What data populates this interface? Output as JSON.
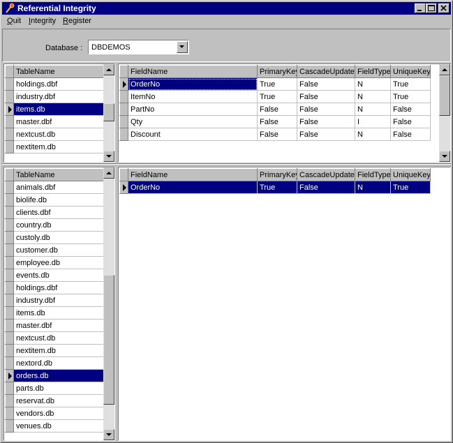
{
  "window": {
    "title": "Referential Integrity"
  },
  "menu": [
    {
      "label": "Quit",
      "ul": "Q",
      "rest": "uit"
    },
    {
      "label": "Integrity",
      "ul": "I",
      "rest": "ntegrity"
    },
    {
      "label": "Register",
      "ul": "R",
      "rest": "egister"
    }
  ],
  "database": {
    "label": "Database :",
    "value": "DBDEMOS"
  },
  "top_tables": {
    "header": "TableName",
    "rows": [
      "holdings.dbf",
      "industry.dbf",
      "items.db",
      "master.dbf",
      "nextcust.db",
      "nextitem.db"
    ],
    "selected": "items.db"
  },
  "top_fields": {
    "headers": [
      "FieldName",
      "PrimaryKey",
      "CascadeUpdate",
      "FieldType",
      "UniqueKey"
    ],
    "rows": [
      [
        "OrderNo",
        "True",
        "False",
        "N",
        "True"
      ],
      [
        "ItemNo",
        "True",
        "False",
        "N",
        "True"
      ],
      [
        "PartNo",
        "False",
        "False",
        "N",
        "False"
      ],
      [
        "Qty",
        "False",
        "False",
        "I",
        "False"
      ],
      [
        "Discount",
        "False",
        "False",
        "N",
        "False"
      ]
    ]
  },
  "bottom_tables": {
    "header": "TableName",
    "rows": [
      "animals.dbf",
      "biolife.db",
      "clients.dbf",
      "country.db",
      "custoly.db",
      "customer.db",
      "employee.db",
      "events.db",
      "holdings.dbf",
      "industry.dbf",
      "items.db",
      "master.dbf",
      "nextcust.db",
      "nextitem.db",
      "nextord.db",
      "orders.db",
      "parts.db",
      "reservat.db",
      "vendors.db",
      "venues.db"
    ],
    "selected": "orders.db"
  },
  "bottom_fields": {
    "headers": [
      "FieldName",
      "PrimaryKey",
      "CascadeUpdate",
      "FieldType",
      "UniqueKey"
    ],
    "rows": [
      [
        "OrderNo",
        "True",
        "False",
        "N",
        "True"
      ]
    ]
  },
  "colors": {
    "titlebar": "#000080",
    "selection": "#000080",
    "face": "#c0c0c0"
  }
}
